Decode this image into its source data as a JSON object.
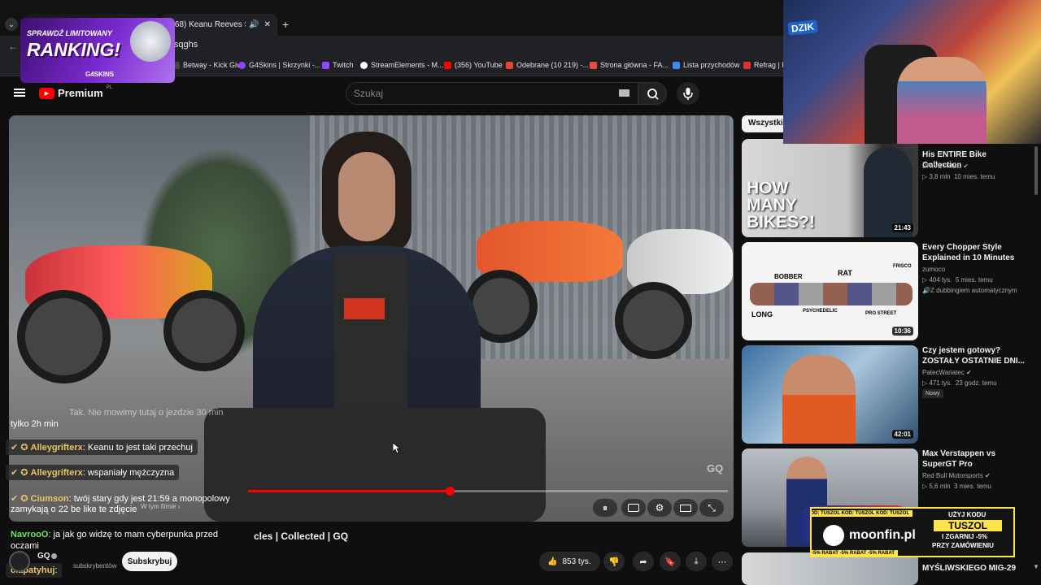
{
  "browser": {
    "tab_title": "(368) Keanu Reeves Shows Of",
    "new_tab_icon": "plus-icon",
    "url_fragment": "GNXsqghs",
    "bookmarks": [
      {
        "label": "Betway - Kick Giv...",
        "color": "#444"
      },
      {
        "label": "G4Skins | Skrzynki -...",
        "color": "#8e44ff"
      },
      {
        "label": "Twitch",
        "color": "#9146ff"
      },
      {
        "label": "StreamElements - M...",
        "color": "#ffffff"
      },
      {
        "label": "(356) YouTube",
        "color": "#ff0000"
      },
      {
        "label": "Odebrane (10 219) -...",
        "color": "#ea4335"
      },
      {
        "label": "Strona główna - FA...",
        "color": "#e74c3c"
      },
      {
        "label": "Lista przychodów",
        "color": "#4285f4"
      },
      {
        "label": "Refrag | D",
        "color": "#e0303a"
      }
    ]
  },
  "youtube": {
    "logo_text": "Premium",
    "logo_country": "PL",
    "search_placeholder": "Szukaj",
    "video_title": "Keanu Reeves Shows Off His Most Prized Motorcycles | Collected | GQ",
    "video_title_visible": "cles | Collected | GQ",
    "watermark": "GQ",
    "in_this_video": "W tym filmie",
    "progress_fraction": 0.42,
    "channel": {
      "name": "GQ",
      "subscribers": "subskrybentów",
      "subscribe_label": "Subskrybuj"
    },
    "likes": "853 tys.",
    "chip_label": "Wszystkie"
  },
  "sidebar_videos": [
    {
      "title": "His ENTIRE Bike Collection",
      "channel": "DRIVETRIBE",
      "verified": true,
      "views": "3,8 mln",
      "age": "10 mies. temu",
      "duration": "21:43",
      "thumb_text": "HOW MANY BIKES?!",
      "badge": ""
    },
    {
      "title": "Every Chopper Style Explained in 10 Minutes",
      "channel": "zumoco",
      "verified": false,
      "views": "404 tys.",
      "age": "5 mies. temu",
      "duration": "10:36",
      "thumb_labels": [
        "BOBBER",
        "RAT",
        "FRISCO",
        "LONG",
        "PSYCHEDELIC",
        "PRO STREET"
      ],
      "badge": "Z dubbingiem automatycznym"
    },
    {
      "title": "Czy jestem gotowy? ZOSTAŁY OSTATNIE DNI...",
      "channel": "PatecWariatec",
      "verified": true,
      "views": "471 tys.",
      "age": "23 godz. temu",
      "duration": "42:01",
      "badge": "Nowy"
    },
    {
      "title": "Max Verstappen vs SuperGT Pro",
      "channel": "Red Bull Motorsports",
      "verified": true,
      "views": "5,6 mln",
      "age": "3 mies. temu",
      "duration": "",
      "badge": ""
    },
    {
      "title": "MYŚLIWSKIEGO MIG-29",
      "channel": "",
      "verified": false,
      "views": "",
      "age": "",
      "duration": "",
      "badge": ""
    }
  ],
  "chat": [
    {
      "user": "",
      "message": "Tak. Nie mowimy tutaj o jezdzie 30 min",
      "faded": true
    },
    {
      "user": "",
      "message": "tylko 2h min",
      "faded": true
    },
    {
      "user": "Alleygrifterx",
      "message": "Keanu to jest taki przechuj",
      "faded": false
    },
    {
      "user": "Alleygrifterx",
      "message": "wspaniały mężczyzna",
      "faded": false
    },
    {
      "user": "Ciumson",
      "message": "twój stary gdy jest 21:59 a monopolowy",
      "faded": false
    },
    {
      "user": "",
      "message": "zamykają o 22 be like te zdjęcie",
      "faded": false
    },
    {
      "user": "NavrooO",
      "message": "ja jak go widzę to mam cyberpunka przed",
      "faded": false
    },
    {
      "user": "",
      "message": "oczami",
      "faded": false
    },
    {
      "user": "ciapatyhuj",
      "message": "",
      "faded": false
    }
  ],
  "overlays": {
    "g4skins": {
      "line1": "SPRAWDŹ LIMITOWANY",
      "line2": "RANKING!",
      "brand": "G4SKINS"
    },
    "moonfin": {
      "brand": "moonfin.pl",
      "line1": "UŻYJ KODU",
      "line2": "TUSZOL",
      "line3": "I ZGARNIJ -5%",
      "line4": "PRZY ZAMÓWIENIU",
      "ticker": "KOD: TUSZOL KOD: TUSZOL KOD: TUSZOL",
      "ticker2": "-5% RABAT -5% RABAT -5% RABAT"
    },
    "webcam_logo": "DZIK"
  },
  "colors": {
    "accent": "#ff0000",
    "chat_user": "#e9c46a",
    "moonfin_yellow": "#ffe34d"
  }
}
